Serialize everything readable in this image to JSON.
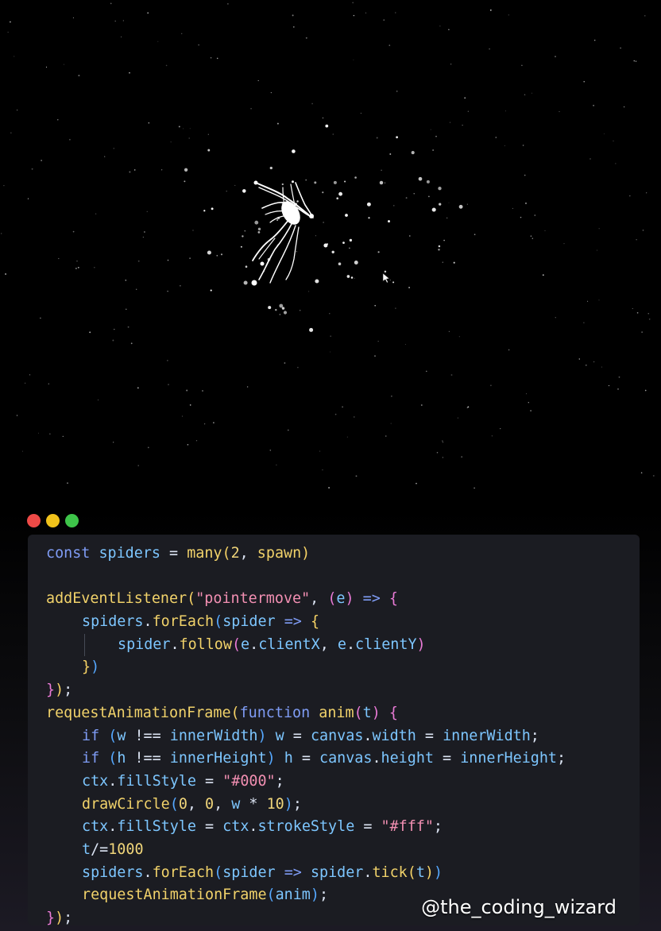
{
  "window": {
    "controls": [
      {
        "name": "close",
        "color": "#ee4a47"
      },
      {
        "name": "minimize",
        "color": "#f1c21b"
      },
      {
        "name": "maximize",
        "color": "#3ec54a"
      }
    ]
  },
  "colors": {
    "keyword": "#7f9cf5",
    "variable": "#7dc6ff",
    "function": "#f1d26a",
    "string": "#f28fb2",
    "number": "#f0d57a",
    "operator": "#dbe3f2",
    "bracket_1": "#f6d265",
    "bracket_2": "#e97ad6",
    "bracket_3": "#55a8ff",
    "panel_background": "#1b1c22"
  },
  "code": {
    "lines": [
      {
        "indent": 0,
        "tokens": [
          [
            "kw",
            "const"
          ],
          [
            "op",
            " "
          ],
          [
            "var",
            "spiders"
          ],
          [
            "op",
            " = "
          ],
          [
            "fn",
            "many"
          ],
          [
            "p1",
            "("
          ],
          [
            "num",
            "2"
          ],
          [
            "op",
            ", "
          ],
          [
            "fn",
            "spawn"
          ],
          [
            "p1",
            ")"
          ]
        ]
      },
      {
        "indent": 0,
        "tokens": []
      },
      {
        "indent": 0,
        "tokens": [
          [
            "fn",
            "addEventListener"
          ],
          [
            "p1",
            "("
          ],
          [
            "str",
            "\"pointermove\""
          ],
          [
            "op",
            ", "
          ],
          [
            "p2",
            "("
          ],
          [
            "var",
            "e"
          ],
          [
            "p2",
            ")"
          ],
          [
            "op",
            " "
          ],
          [
            "kw",
            "=>"
          ],
          [
            "op",
            " "
          ],
          [
            "p2",
            "{"
          ]
        ]
      },
      {
        "indent": 1,
        "tokens": [
          [
            "var",
            "spiders"
          ],
          [
            "op",
            "."
          ],
          [
            "fn",
            "forEach"
          ],
          [
            "p3",
            "("
          ],
          [
            "var",
            "spider"
          ],
          [
            "op",
            " "
          ],
          [
            "kw",
            "=>"
          ],
          [
            "op",
            " "
          ],
          [
            "p1",
            "{"
          ]
        ]
      },
      {
        "indent": 2,
        "tokens": [
          [
            "var",
            "spider"
          ],
          [
            "op",
            "."
          ],
          [
            "fn",
            "follow"
          ],
          [
            "p2",
            "("
          ],
          [
            "var",
            "e"
          ],
          [
            "op",
            "."
          ],
          [
            "var",
            "clientX"
          ],
          [
            "op",
            ", "
          ],
          [
            "var",
            "e"
          ],
          [
            "op",
            "."
          ],
          [
            "var",
            "clientY"
          ],
          [
            "p2",
            ")"
          ]
        ]
      },
      {
        "indent": 1,
        "tokens": [
          [
            "p1",
            "}"
          ],
          [
            "p3",
            ")"
          ]
        ]
      },
      {
        "indent": 0,
        "tokens": [
          [
            "p2",
            "}"
          ],
          [
            "p1",
            ")"
          ],
          [
            "op",
            ";"
          ]
        ]
      },
      {
        "indent": 0,
        "tokens": [
          [
            "fn",
            "requestAnimationFrame"
          ],
          [
            "p1",
            "("
          ],
          [
            "kw",
            "function"
          ],
          [
            "op",
            " "
          ],
          [
            "fn",
            "anim"
          ],
          [
            "p2",
            "("
          ],
          [
            "var",
            "t"
          ],
          [
            "p2",
            ")"
          ],
          [
            "op",
            " "
          ],
          [
            "p2",
            "{"
          ]
        ]
      },
      {
        "indent": 1,
        "tokens": [
          [
            "kw",
            "if"
          ],
          [
            "op",
            " "
          ],
          [
            "p3",
            "("
          ],
          [
            "var",
            "w"
          ],
          [
            "op",
            " !== "
          ],
          [
            "var",
            "innerWidth"
          ],
          [
            "p3",
            ")"
          ],
          [
            "op",
            " "
          ],
          [
            "var",
            "w"
          ],
          [
            "op",
            " = "
          ],
          [
            "var",
            "canvas"
          ],
          [
            "op",
            "."
          ],
          [
            "var",
            "width"
          ],
          [
            "op",
            " = "
          ],
          [
            "var",
            "innerWidth"
          ],
          [
            "op",
            ";"
          ]
        ]
      },
      {
        "indent": 1,
        "tokens": [
          [
            "kw",
            "if"
          ],
          [
            "op",
            " "
          ],
          [
            "p3",
            "("
          ],
          [
            "var",
            "h"
          ],
          [
            "op",
            " !== "
          ],
          [
            "var",
            "innerHeight"
          ],
          [
            "p3",
            ")"
          ],
          [
            "op",
            " "
          ],
          [
            "var",
            "h"
          ],
          [
            "op",
            " = "
          ],
          [
            "var",
            "canvas"
          ],
          [
            "op",
            "."
          ],
          [
            "var",
            "height"
          ],
          [
            "op",
            " = "
          ],
          [
            "var",
            "innerHeight"
          ],
          [
            "op",
            ";"
          ]
        ]
      },
      {
        "indent": 1,
        "tokens": [
          [
            "var",
            "ctx"
          ],
          [
            "op",
            "."
          ],
          [
            "var",
            "fillStyle"
          ],
          [
            "op",
            " = "
          ],
          [
            "str",
            "\"#000\""
          ],
          [
            "op",
            ";"
          ]
        ]
      },
      {
        "indent": 1,
        "tokens": [
          [
            "fn",
            "drawCircle"
          ],
          [
            "p3",
            "("
          ],
          [
            "num",
            "0"
          ],
          [
            "op",
            ", "
          ],
          [
            "num",
            "0"
          ],
          [
            "op",
            ", "
          ],
          [
            "var",
            "w"
          ],
          [
            "op",
            " * "
          ],
          [
            "num",
            "10"
          ],
          [
            "p3",
            ")"
          ],
          [
            "op",
            ";"
          ]
        ]
      },
      {
        "indent": 1,
        "tokens": [
          [
            "var",
            "ctx"
          ],
          [
            "op",
            "."
          ],
          [
            "var",
            "fillStyle"
          ],
          [
            "op",
            " = "
          ],
          [
            "var",
            "ctx"
          ],
          [
            "op",
            "."
          ],
          [
            "var",
            "strokeStyle"
          ],
          [
            "op",
            " = "
          ],
          [
            "str",
            "\"#fff\""
          ],
          [
            "op",
            ";"
          ]
        ]
      },
      {
        "indent": 1,
        "tokens": [
          [
            "var",
            "t"
          ],
          [
            "op",
            "/="
          ],
          [
            "num",
            "1000"
          ]
        ]
      },
      {
        "indent": 1,
        "tokens": [
          [
            "var",
            "spiders"
          ],
          [
            "op",
            "."
          ],
          [
            "fn",
            "forEach"
          ],
          [
            "p3",
            "("
          ],
          [
            "var",
            "spider"
          ],
          [
            "op",
            " "
          ],
          [
            "kw",
            "=>"
          ],
          [
            "op",
            " "
          ],
          [
            "var",
            "spider"
          ],
          [
            "op",
            "."
          ],
          [
            "fn",
            "tick"
          ],
          [
            "p1",
            "("
          ],
          [
            "var",
            "t"
          ],
          [
            "p1",
            ")"
          ],
          [
            "p3",
            ")"
          ]
        ]
      },
      {
        "indent": 1,
        "tokens": [
          [
            "fn",
            "requestAnimationFrame"
          ],
          [
            "p3",
            "("
          ],
          [
            "var",
            "anim"
          ],
          [
            "p3",
            ")"
          ],
          [
            "op",
            ";"
          ]
        ]
      },
      {
        "indent": 0,
        "tokens": [
          [
            "p2",
            "}"
          ],
          [
            "p1",
            ")"
          ],
          [
            "op",
            ";"
          ]
        ]
      }
    ]
  },
  "watermark": "@the_coding_wizard"
}
